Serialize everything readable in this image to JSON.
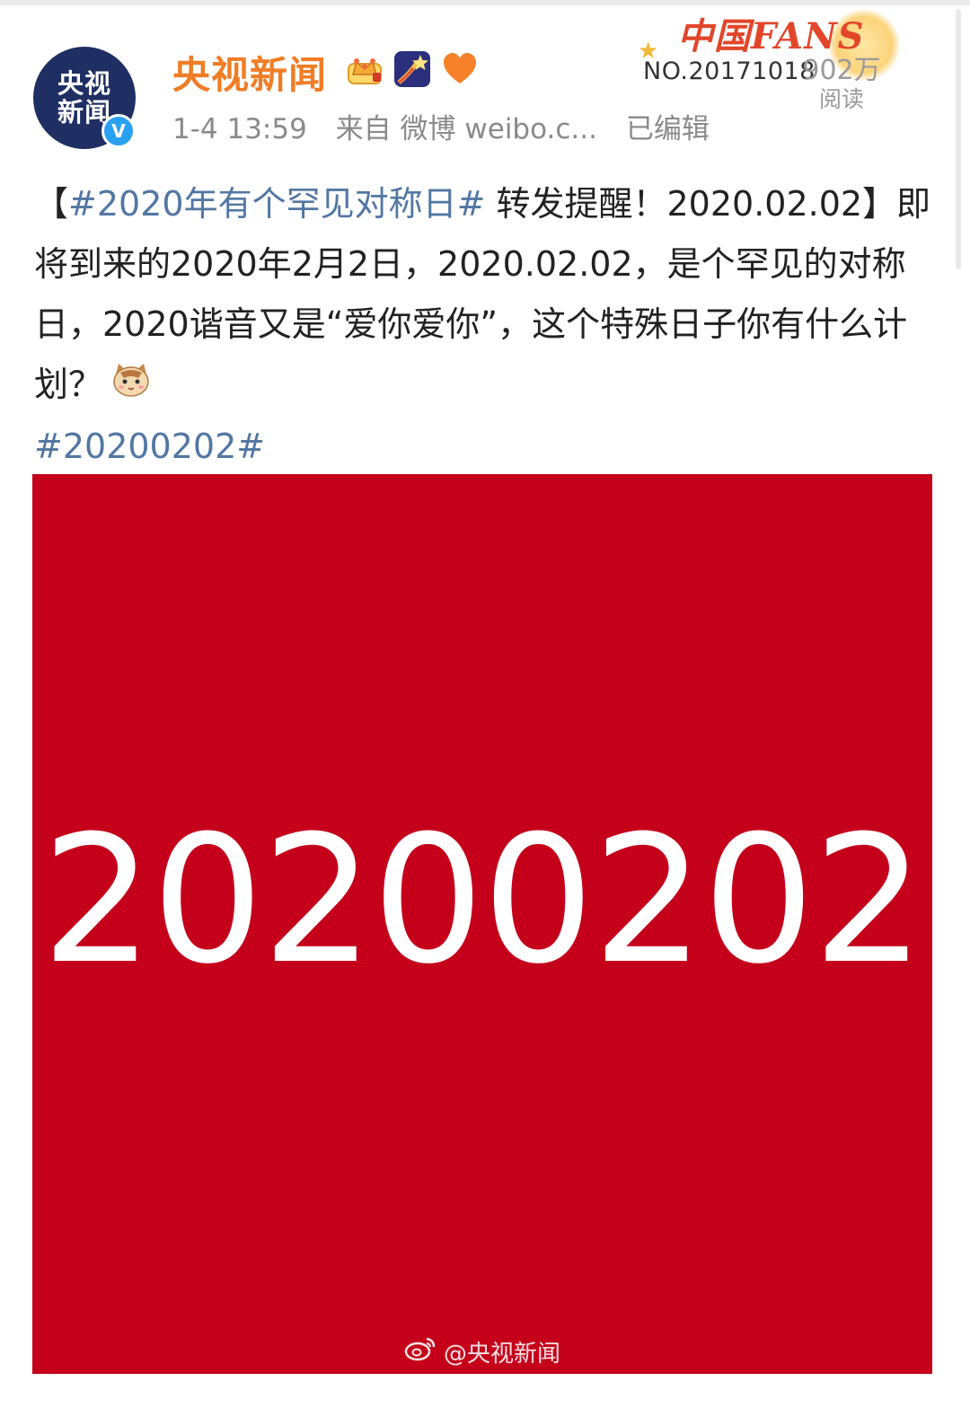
{
  "account": {
    "name": "央视新闻",
    "avatar_lines": [
      "央视",
      "新闻"
    ],
    "verified_mark": "V",
    "meta": {
      "time": "1-4 13:59",
      "source": "来自 微博 weibo.c...",
      "edited": "已编辑"
    }
  },
  "fan_badge": {
    "title": "中国FANS",
    "number": "NO.20171018",
    "reads_count": "902万",
    "reads_label": "阅读"
  },
  "post": {
    "bracket_open": "【",
    "topic1": "#2020年有个罕见对称日#",
    "text1": " 转发提醒！2020.02.02】即将到来的2020年2月2日，2020.02.02，是个罕见的对称日，2020谐音又是“爱你爱你”，这个特殊日子你有什么计划？",
    "topic2": "#20200202#"
  },
  "image": {
    "big_text": "20200202",
    "watermark": "@央视新闻",
    "background": "#c5001a"
  },
  "colors": {
    "username": "#f07d25",
    "topic_link": "#5277a3",
    "meta_gray": "#8a8a8a"
  },
  "icons": [
    "crown-badge-icon",
    "shooting-star-badge-icon",
    "heart-badge-icon",
    "cat-emoji-icon",
    "weibo-logo-icon",
    "verified-icon"
  ]
}
